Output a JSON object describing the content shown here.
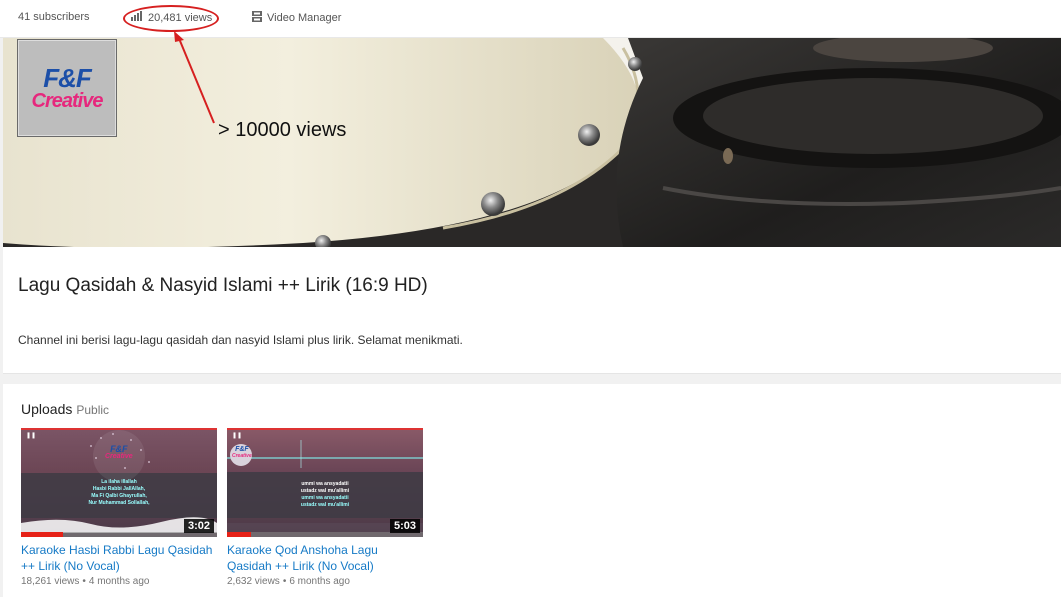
{
  "stats": {
    "subscribers": "41 subscribers",
    "views": "20,481 views",
    "video_manager": "Video Manager"
  },
  "annotation": {
    "text": "> 10000 views"
  },
  "logo": {
    "line1": "F&F",
    "line2": "Creative"
  },
  "channel": {
    "title": "Lagu Qasidah & Nasyid Islami ++ Lirik (16:9 HD)",
    "description": "Channel ini berisi lagu-lagu qasidah dan nasyid Islami plus lirik. Selamat menikmati."
  },
  "uploads": {
    "heading": "Uploads",
    "visibility": "Public",
    "videos": [
      {
        "title": "Karaoke Hasbi Rabbi Lagu Qasidah ++ Lirik (No Vocal)",
        "duration": "3:02",
        "views": "18,261 views",
        "age": "4 months ago",
        "lyrics": [
          "La ilaha illallah",
          "Hasbi Rabbi JallAllah,",
          "Ma Fi Qalbi Ghayrullah,",
          "Nur Muhammad Sollallah,"
        ]
      },
      {
        "title": "Karaoke Qod Anshoha Lagu Qasidah ++ Lirik (No Vocal)",
        "duration": "5:03",
        "views": "2,632 views",
        "age": "6 months ago",
        "lyrics": [
          "ummi wa ansyadatii",
          "ustadz wal mu'allimi",
          "ummi wa ansyadatii",
          "ustadz wal mu'allimi"
        ]
      }
    ]
  },
  "colors": {
    "annotation_red": "#d62020",
    "link_blue": "#167ac6",
    "logo_blue": "#1c4fa8",
    "logo_pink": "#e6287d"
  }
}
